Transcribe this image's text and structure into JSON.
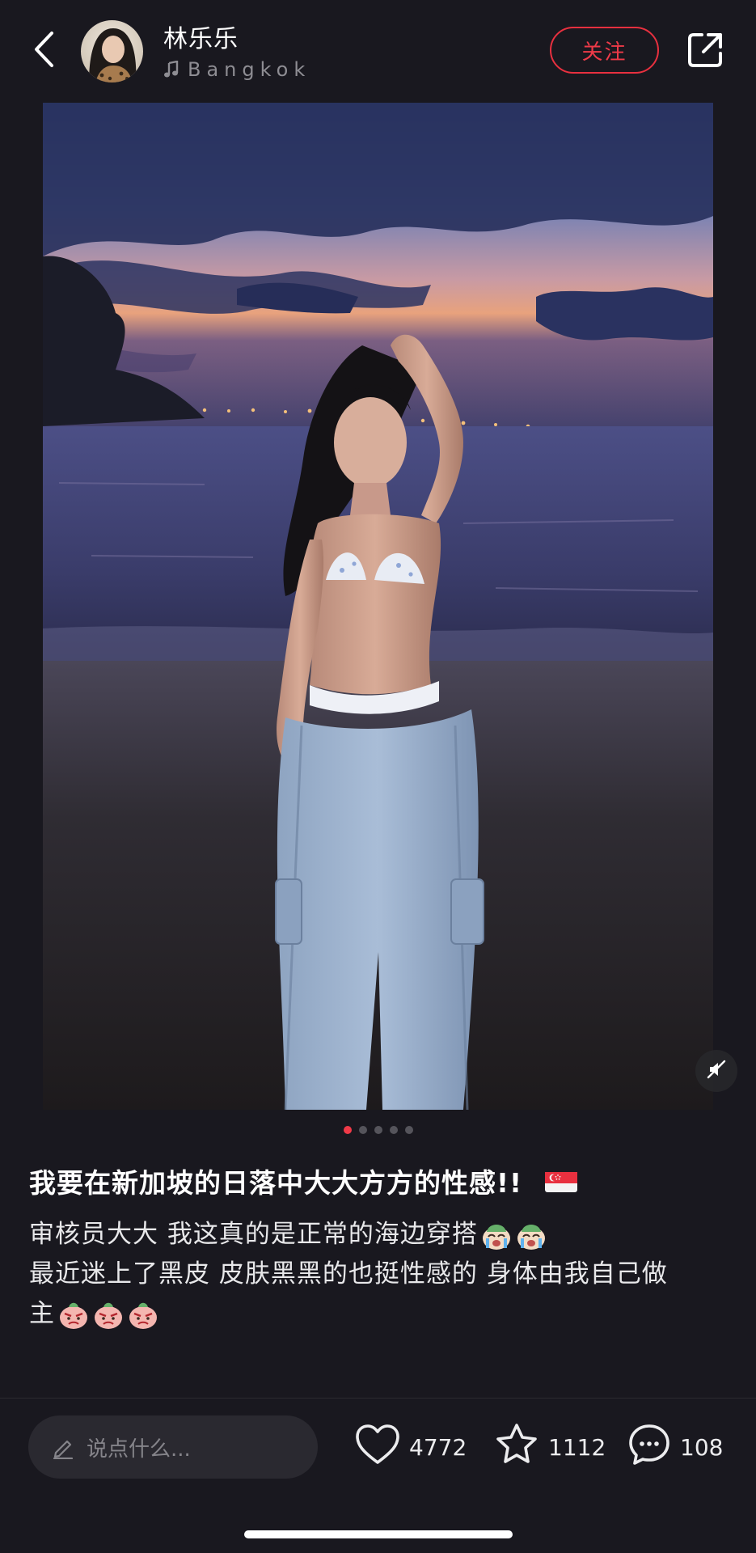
{
  "header": {
    "username": "林乐乐",
    "location": "Bangkok",
    "follow_label": "关注"
  },
  "post": {
    "title": "我要在新加坡的日落中大大方方的性感!!",
    "title_flag": "singapore-flag",
    "lines": [
      "审核员大大 我这真的是正常的海边穿搭",
      "最近迷上了黑皮 皮肤黑黑的也挺性感的 身体由我自己做",
      "主"
    ],
    "image_count": 5,
    "active_image": 1
  },
  "bottom_bar": {
    "comment_placeholder": "说点什么...",
    "likes": "4772",
    "favorites": "1112",
    "comments": "108"
  },
  "colors": {
    "background": "#19181f",
    "accent": "#ee3a48",
    "muted_text": "#8e8d93"
  }
}
